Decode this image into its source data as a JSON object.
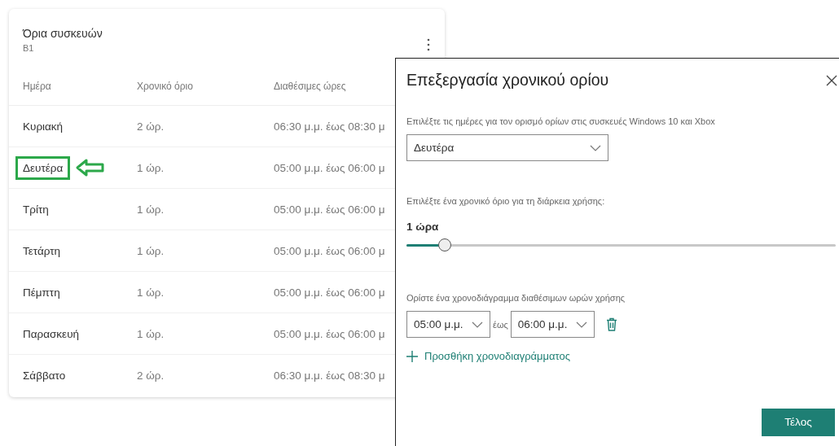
{
  "card": {
    "title": "Όρια συσκευών",
    "subtitle": "B1",
    "columns": [
      "Ημέρα",
      "Χρονικό όριο",
      "Διαθέσιμες ώρες"
    ],
    "rows": [
      {
        "day": "Κυριακή",
        "limit": "2 ώρ.",
        "hours": "06:30 μ.μ. έως 08:30 μ",
        "highlighted": false
      },
      {
        "day": "Δευτέρα",
        "limit": "1 ώρ.",
        "hours": "05:00 μ.μ. έως 06:00 μ",
        "highlighted": true
      },
      {
        "day": "Τρίτη",
        "limit": "1 ώρ.",
        "hours": "05:00 μ.μ. έως 06:00 μ",
        "highlighted": false
      },
      {
        "day": "Τετάρτη",
        "limit": "1 ώρ.",
        "hours": "05:00 μ.μ. έως 06:00 μ",
        "highlighted": false
      },
      {
        "day": "Πέμπτη",
        "limit": "1 ώρ.",
        "hours": "05:00 μ.μ. έως 06:00 μ",
        "highlighted": false
      },
      {
        "day": "Παρασκευή",
        "limit": "1 ώρ.",
        "hours": "05:00 μ.μ. έως 06:00 μ",
        "highlighted": false
      },
      {
        "day": "Σάββατο",
        "limit": "2 ώρ.",
        "hours": "06:30 μ.μ. έως 08:30 μ",
        "highlighted": false
      }
    ]
  },
  "panel": {
    "title": "Επεξεργασία χρονικού ορίου",
    "days_label": "Επιλέξτε τις ημέρες για τον ορισμό ορίων στις συσκευές Windows 10 και Xbox",
    "day_value": "Δευτέρα",
    "limit_label": "Επιλέξτε ένα χρονικό όριο για τη διάρκεια χρήσης:",
    "limit_value": "1 ώρα",
    "slider": {
      "level": 0.09
    },
    "schedule_label": "Ορίστε ένα χρονοδιάγραμμα διαθέσιμων ωρών χρήσης",
    "from": "05:00 μ.μ.",
    "separator": "έως",
    "to": "06:00 μ.μ.",
    "add_link": "Προσθήκη χρονοδιαγράμματος",
    "done_button": "Τέλος"
  }
}
